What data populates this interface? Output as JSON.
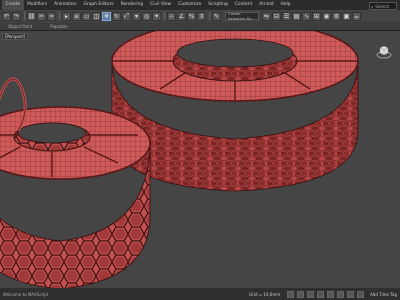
{
  "menubar": {
    "items": [
      "Create",
      "Modifiers",
      "Animation",
      "Graph Editors",
      "Rendering",
      "Civil View",
      "Customize",
      "Scripting",
      "Content",
      "Arnold",
      "Help"
    ],
    "search_label": "Search"
  },
  "toolbar": {
    "view_dropdown": "Create Selection Se"
  },
  "ribbon": {
    "tabs": [
      "Object Paint",
      "Populate"
    ]
  },
  "viewport": {
    "label": "[Perspect]"
  },
  "statusbar": {
    "left_text": "Welcome to MAXScript",
    "grid_readout": "Grid = 10,0mm",
    "add_time_tag": "Add Time Tag"
  },
  "colors": {
    "mesh_fill": "#c25050",
    "mesh_dark": "#7a2424",
    "wire": "#3a0f0f",
    "viewport_bg": "#454545"
  }
}
